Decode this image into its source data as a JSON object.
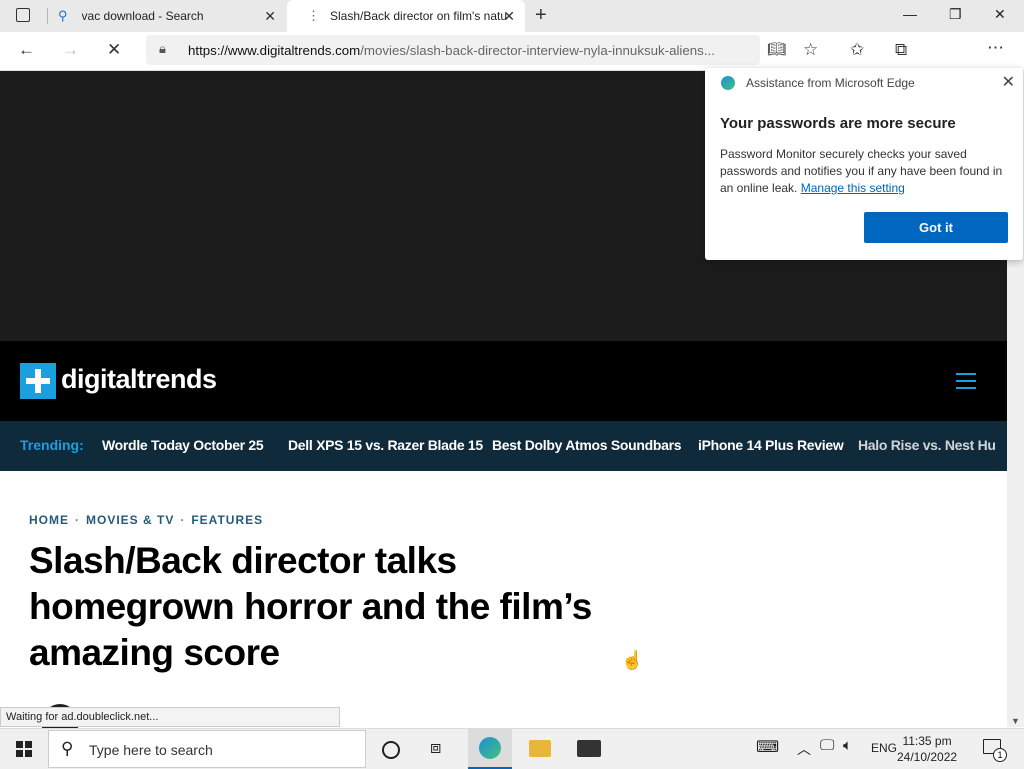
{
  "tabs": [
    {
      "title": "vac download - Search",
      "icon": "search-icon"
    },
    {
      "title": "Slash/Back director on film's natu",
      "icon": "loading-icon"
    }
  ],
  "address": {
    "domain": "https://www.digitaltrends.com",
    "path": "/movies/slash-back-director-interview-nyla-innuksuk-aliens..."
  },
  "site": {
    "logo": "digitaltrends",
    "trending_label": "Trending:",
    "trending": [
      "Wordle Today October 25",
      "Dell XPS 15 vs. Razer Blade 15",
      "Best Dolby Atmos Soundbars",
      "iPhone 14 Plus Review",
      "Halo Rise vs. Nest Hu"
    ],
    "breadcrumbs": [
      "HOME",
      "MOVIES & TV",
      "FEATURES"
    ],
    "headline": "Slash/Back director talks homegrown horror and the film’s amazing score"
  },
  "status": "Waiting for ad.doubleclick.net...",
  "popup": {
    "header": "Assistance from Microsoft Edge",
    "title": "Your passwords are more secure",
    "body": "Password Monitor securely checks your saved passwords and notifies you if any have been found in an online leak.",
    "link": "Manage this setting",
    "button": "Got it"
  },
  "taskbar": {
    "search_placeholder": "Type here to search",
    "lang": "ENG",
    "time": "11:35 pm",
    "date": "24/10/2022",
    "notifications": "1"
  },
  "colors": {
    "brand": "#1aa0e0",
    "button": "#0067c0"
  }
}
